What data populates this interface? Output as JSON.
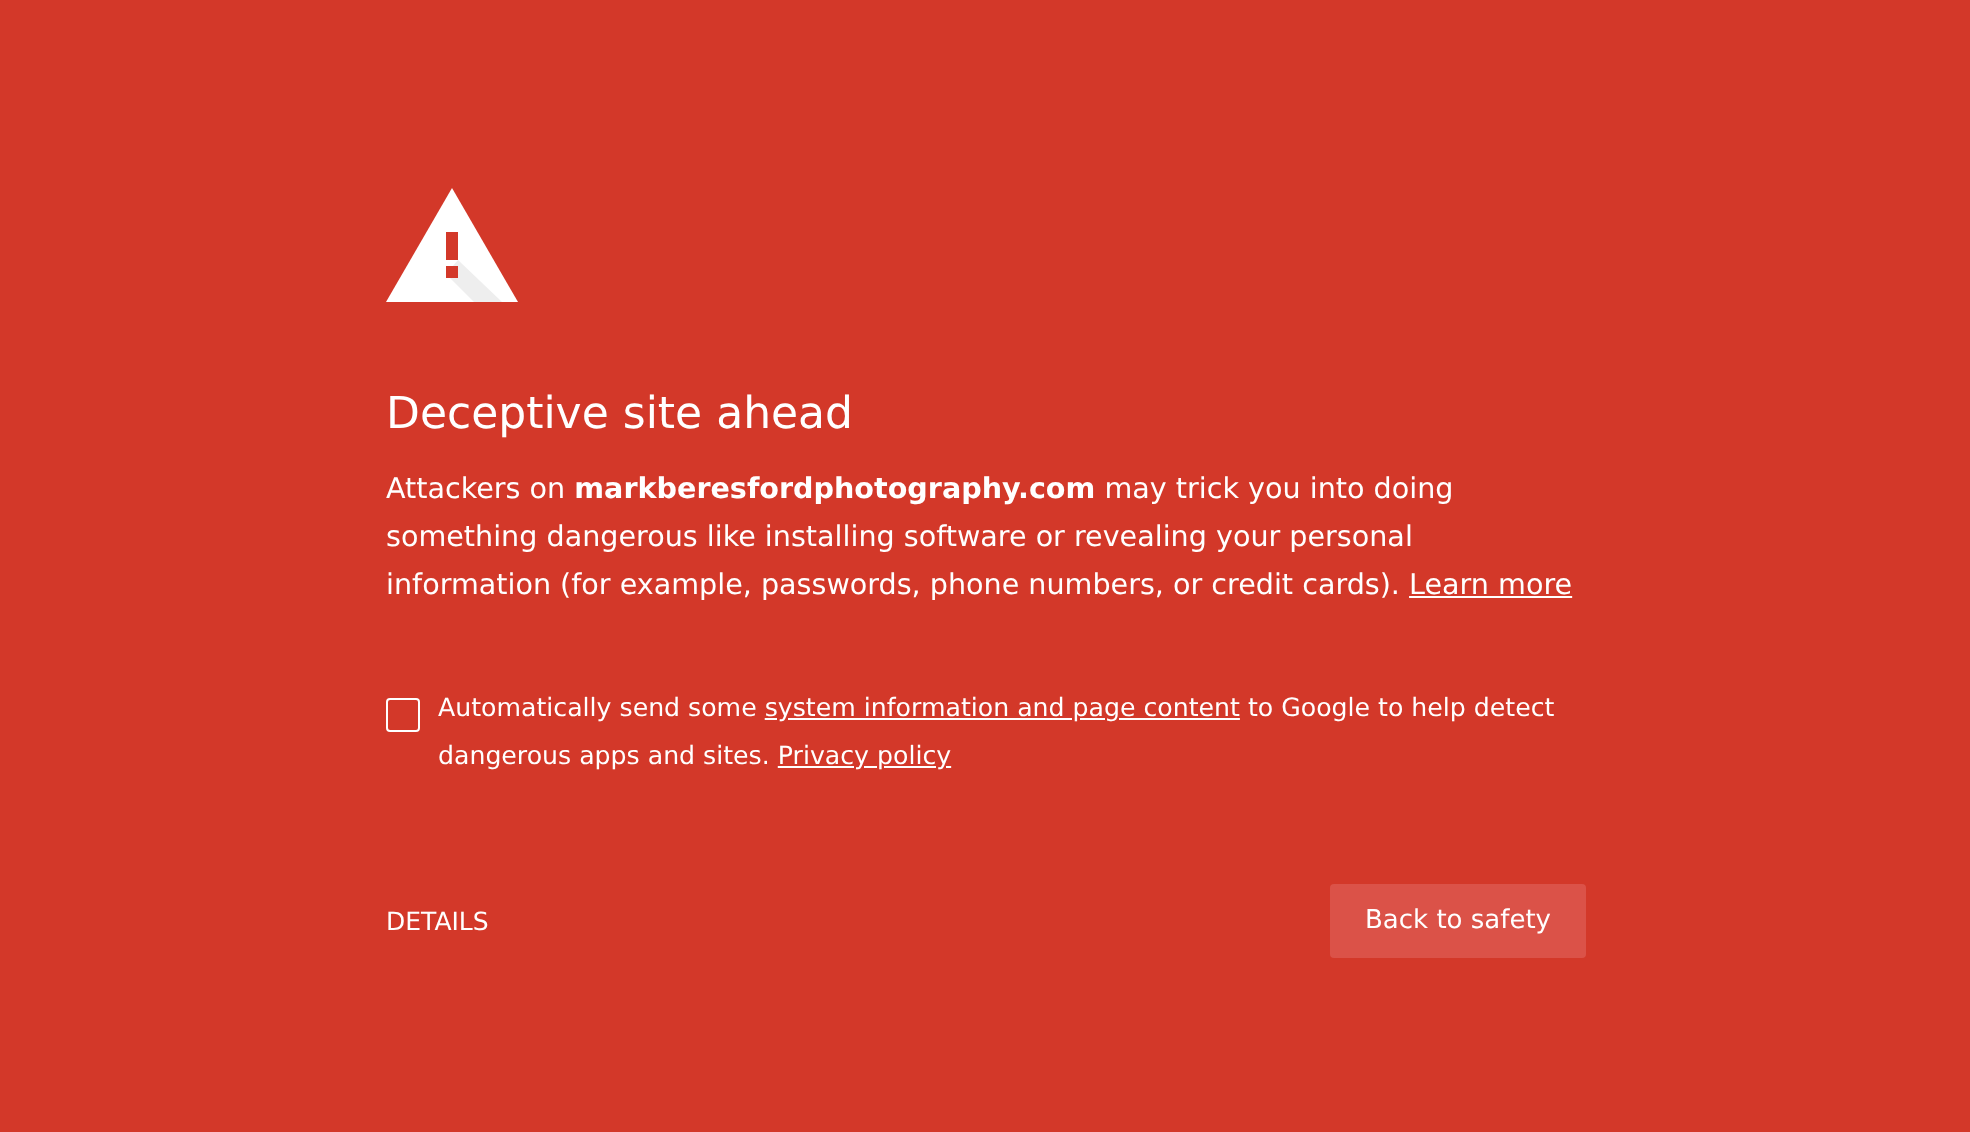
{
  "heading": "Deceptive site ahead",
  "message": {
    "text": "Attackers on **markberesfordphotography.com** may trick you into doing something dangerous like installing software or revealing your personal information (for example, passwords, phone numbers, or credit cards).",
    "link": "Learn more"
  },
  "consent": {
    "checked": false,
    "text_before": "Automatically send some",
    "link": "system information and page content",
    "text_after": "to Google to help detect dangerous apps and sites.",
    "privacy_link": "Privacy policy"
  },
  "details_button": "DETAILS",
  "primary_button": "Back to safety"
}
